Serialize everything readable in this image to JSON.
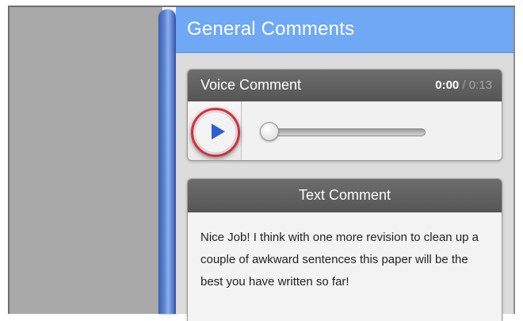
{
  "panel": {
    "title": "General Comments"
  },
  "voice_comment": {
    "title": "Voice Comment",
    "current_time": "0:00",
    "separator": "/",
    "total_time": "0:13",
    "progress_fraction": 0.0,
    "play_icon": "play-icon",
    "highlight_color": "#d3303a"
  },
  "text_comment": {
    "title": "Text Comment",
    "body": "Nice Job! I think with one more revision to clean up a couple of awkward sentences this paper will be the best you have written so far!"
  },
  "colors": {
    "header_blue": "#6fa8f5",
    "bar_gray": "#5f5f5f",
    "play_blue": "#2f5fd6"
  }
}
